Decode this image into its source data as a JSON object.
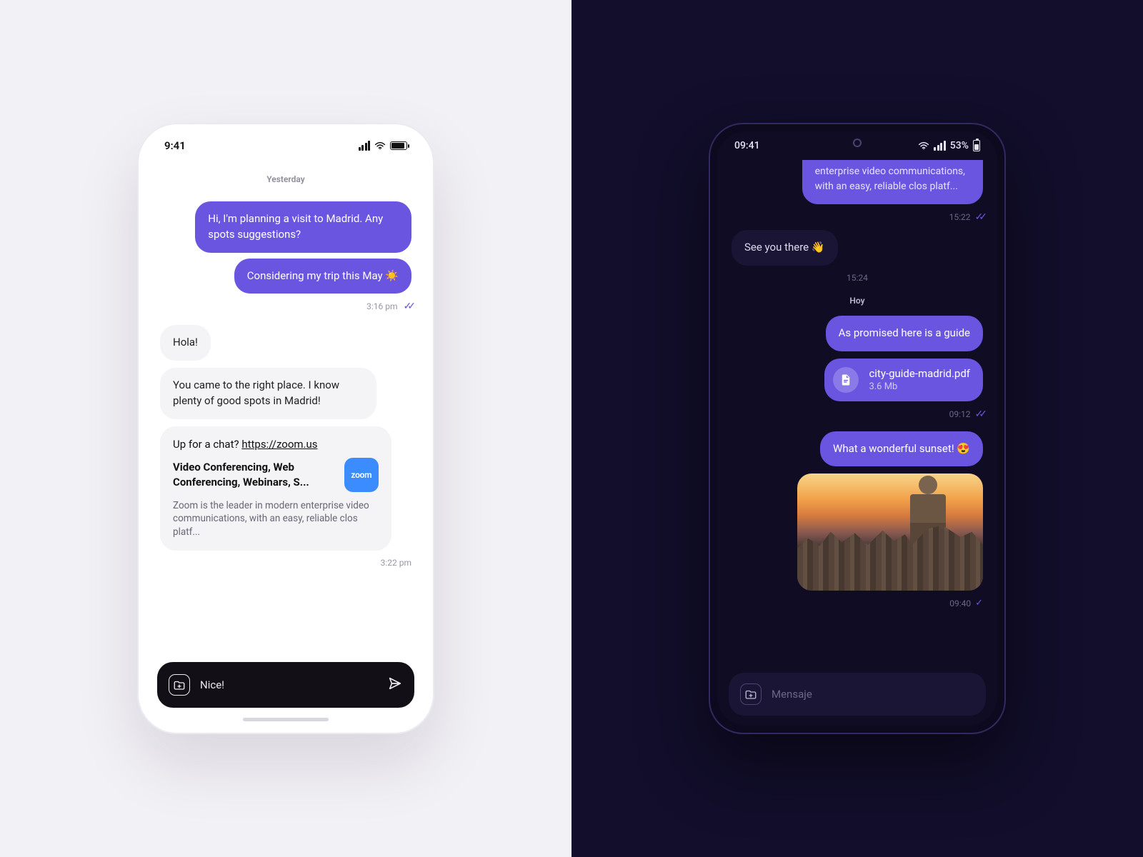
{
  "light": {
    "status": {
      "time": "9:41"
    },
    "divider": "Yesterday",
    "sent1": "Hi, I'm planning a visit to Madrid. Any spots suggestions?",
    "sent2": "Considering my trip this May ☀️",
    "sent_time": "3:16 pm",
    "recv1": "Hola!",
    "recv2": "You came to the right place. I know plenty of good spots in Madrid!",
    "link_card": {
      "prompt_prefix": "Up for a chat? ",
      "url": "https://zoom.us",
      "title": "Video Conferencing, Web Conferencing, Webinars, S...",
      "badge": "zoom",
      "desc": "Zoom is the leader in modern enterprise video communications, with an easy, reliable clos platf..."
    },
    "recv_time": "3:22 pm",
    "composer": {
      "value": "Nice!"
    }
  },
  "dark": {
    "status": {
      "time": "09:41",
      "battery": "53%"
    },
    "partial_card": "enterprise video communications, with an easy, reliable clos platf...",
    "t1": "15:22",
    "recv1": "See you there 👋",
    "t2": "15:24",
    "divider": "Hoy",
    "sent1": "As promised here is a guide",
    "file": {
      "name": "city-guide-madrid.pdf",
      "size": "3.6 Mb"
    },
    "t3": "09:12",
    "sent2": "What a wonderful sunset! 😍",
    "t4": "09:40",
    "composer": {
      "placeholder": "Mensaje"
    }
  }
}
